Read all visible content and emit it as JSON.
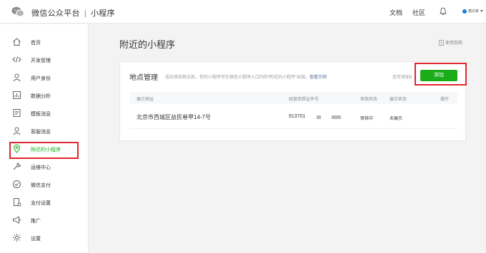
{
  "header": {
    "brand": "微信公众平台",
    "separator": "|",
    "product": "小程序",
    "links": [
      "文档",
      "社区"
    ],
    "account_name": "蕴识家"
  },
  "sidebar": {
    "items": [
      {
        "label": "首页",
        "icon": "home-icon"
      },
      {
        "label": "开发管理",
        "icon": "code-icon"
      },
      {
        "label": "用户身份",
        "icon": "user-icon"
      },
      {
        "label": "数据分析",
        "icon": "chart-icon"
      },
      {
        "label": "模板消息",
        "icon": "template-icon"
      },
      {
        "label": "客服消息",
        "icon": "customer-service-icon"
      },
      {
        "label": "附近的小程序",
        "icon": "location-pin-icon",
        "active": true
      },
      {
        "label": "运维中心",
        "icon": "wrench-icon"
      },
      {
        "label": "微信支付",
        "icon": "wechat-pay-icon"
      },
      {
        "label": "支付设置",
        "icon": "payment-settings-icon"
      },
      {
        "label": "推广",
        "icon": "megaphone-icon"
      },
      {
        "label": "设置",
        "icon": "gear-icon"
      }
    ]
  },
  "main": {
    "title": "附近的小程序",
    "guide_label": "使用指南",
    "card": {
      "title": "地点管理",
      "description": "成功添加地点后，你的小程序可在微信小程序入口内的“附近的小程序”出现。",
      "example_link": "查看示例",
      "remaining": "还可添加9",
      "add_button": "添加"
    },
    "table": {
      "headers": [
        "展示地址",
        "经营资质证件号",
        "审核状态",
        "展示状态",
        "操作"
      ],
      "rows": [
        {
          "address": "北京市西城区益民巷甲14-7号",
          "license": "913701",
          "review_status": "审核中",
          "display_status": "未展示"
        }
      ]
    }
  },
  "colors": {
    "accent": "#1aad19",
    "highlight": "#e0262e",
    "link": "#576b95"
  }
}
